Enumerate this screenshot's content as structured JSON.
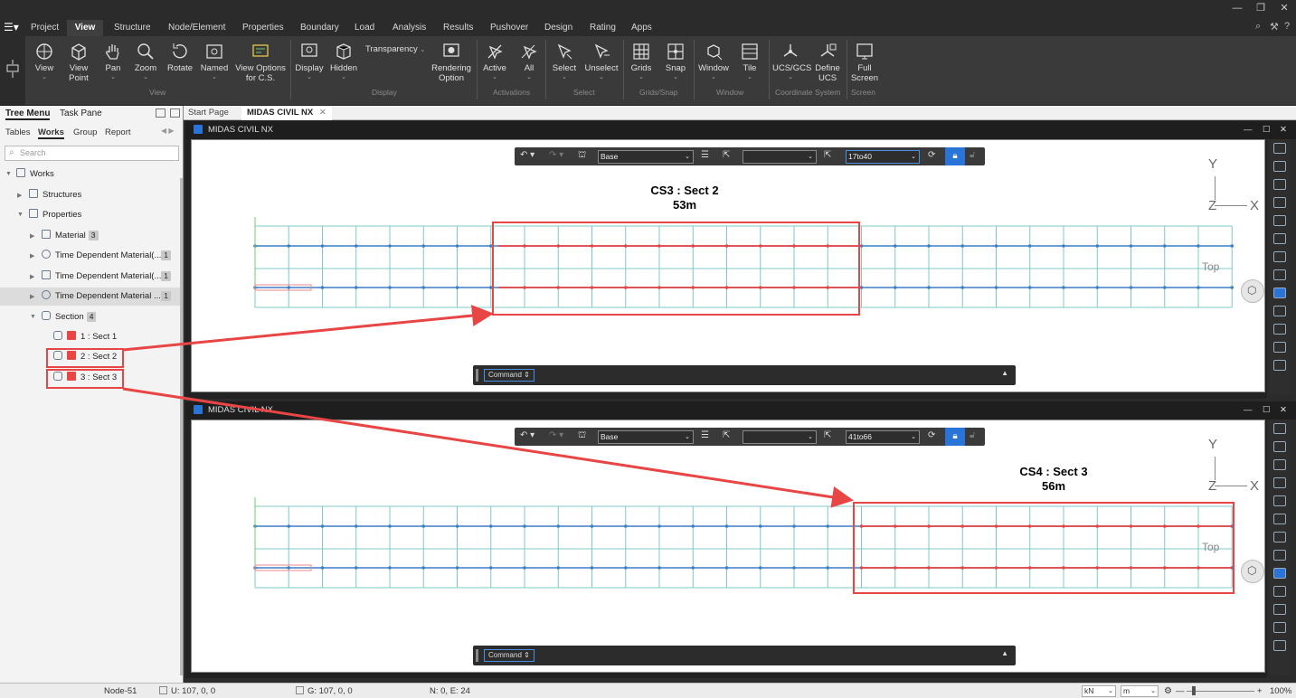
{
  "menu": {
    "items": [
      "Project",
      "View",
      "Structure",
      "Node/Element",
      "Properties",
      "Boundary",
      "Load",
      "Analysis",
      "Results",
      "Pushover",
      "Design",
      "Rating",
      "Apps"
    ],
    "active": "View"
  },
  "ribbon": {
    "view_group": {
      "view": "View",
      "view_point": "View\nPoint",
      "pan": "Pan",
      "zoom": "Zoom",
      "rotate": "Rotate",
      "named": "Named",
      "view_options": "View Options\nfor C.S.",
      "label": "View"
    },
    "display_group": {
      "display": "Display",
      "hidden": "Hidden",
      "transparency": "Transparency",
      "rendering": "Rendering\nOption",
      "label": "Display"
    },
    "activation_group": {
      "active": "Active",
      "all": "All",
      "label": "Activations"
    },
    "select_group": {
      "select": "Select",
      "unselect": "Unselect",
      "label": "Select"
    },
    "grid_group": {
      "grids": "Grids",
      "snap": "Snap",
      "label": "Grids/Snap"
    },
    "window_group": {
      "window": "Window",
      "tile": "Tile",
      "label": "Window"
    },
    "cs_group": {
      "ucs": "UCS/GCS",
      "define": "Define\nUCS",
      "label": "Coordinate System"
    },
    "screen_group": {
      "full": "Full\nScreen",
      "label": "Screen"
    }
  },
  "left_panel": {
    "tabs": [
      "Tree Menu",
      "Task Pane"
    ],
    "subtabs": [
      "Tables",
      "Works",
      "Group",
      "Report"
    ],
    "search_placeholder": "Search",
    "tree": {
      "works": "Works",
      "structures": "Structures",
      "properties": "Properties",
      "material": "Material",
      "material_count": "3",
      "tdm1": "Time Dependent Material(...",
      "tdm1_count": "1",
      "tdm2": "Time Dependent Material(...",
      "tdm2_count": "1",
      "tdm3": "Time Dependent Material ...",
      "tdm3_count": "1",
      "section": "Section",
      "section_count": "4",
      "sect1": "1 : Sect 1",
      "sect2": "2 : Sect 2",
      "sect3": "3 : Sect 3"
    }
  },
  "doc_tabs": [
    "Start Page",
    "MIDAS CIVIL NX"
  ],
  "viewports": [
    {
      "title": "MIDAS CIVIL NX",
      "base": "Base",
      "stage": "17to40",
      "command": "Command",
      "annotation_title": "CS3 : Sect 2",
      "annotation_length": "53m",
      "view_label": "Top"
    },
    {
      "title": "MIDAS CIVIL NX",
      "base": "Base",
      "stage": "41to66",
      "command": "Command",
      "annotation_title": "CS4 : Sect 3",
      "annotation_length": "56m",
      "view_label": "Top"
    }
  ],
  "axes": {
    "x": "X",
    "y": "Y",
    "z": "Z"
  },
  "status": {
    "node": "Node-51",
    "ucs": "U: 107, 0, 0",
    "gcs": "G: 107, 0, 0",
    "ne": "N: 0, E: 24",
    "force_unit": "kN",
    "length_unit": "m",
    "zoom": "100%"
  },
  "colors": {
    "highlight": "#e84545",
    "mesh": "#7ec8c8",
    "beam": "#3d7fc4",
    "accent": "#2a74d8"
  }
}
